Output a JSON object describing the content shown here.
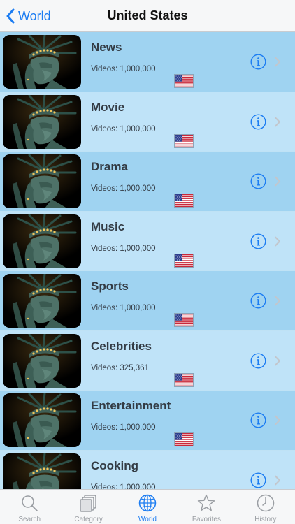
{
  "nav": {
    "back_label": "World",
    "title": "United States"
  },
  "rows": [
    {
      "title": "News",
      "subtitle": "Videos: 1,000,000"
    },
    {
      "title": "Movie",
      "subtitle": "Videos: 1,000,000"
    },
    {
      "title": "Drama",
      "subtitle": "Videos: 1,000,000"
    },
    {
      "title": "Music",
      "subtitle": "Videos: 1,000,000"
    },
    {
      "title": "Sports",
      "subtitle": "Videos: 1,000,000"
    },
    {
      "title": "Celebrities",
      "subtitle": "Videos: 325,361"
    },
    {
      "title": "Entertainment",
      "subtitle": "Videos: 1,000,000"
    },
    {
      "title": "Cooking",
      "subtitle": "Videos: 1,000,000"
    }
  ],
  "row_icons": {
    "thumbnail": "statue-of-liberty-thumbnail",
    "flag": "us-flag-icon",
    "info": "info-icon",
    "disclosure": "chevron-right-icon"
  },
  "tabs": [
    {
      "label": "Search",
      "icon": "search-icon",
      "active": false
    },
    {
      "label": "Category",
      "icon": "category-icon",
      "active": false
    },
    {
      "label": "World",
      "icon": "globe-icon",
      "active": true
    },
    {
      "label": "Favorites",
      "icon": "star-icon",
      "active": false
    },
    {
      "label": "History",
      "icon": "clock-icon",
      "active": false
    }
  ],
  "colors": {
    "accent": "#1b7cf2",
    "row_dark": "#9fd3f1",
    "row_light": "#bfe3f8",
    "text": "#333b44",
    "tab_inactive": "#9a9ea3"
  }
}
